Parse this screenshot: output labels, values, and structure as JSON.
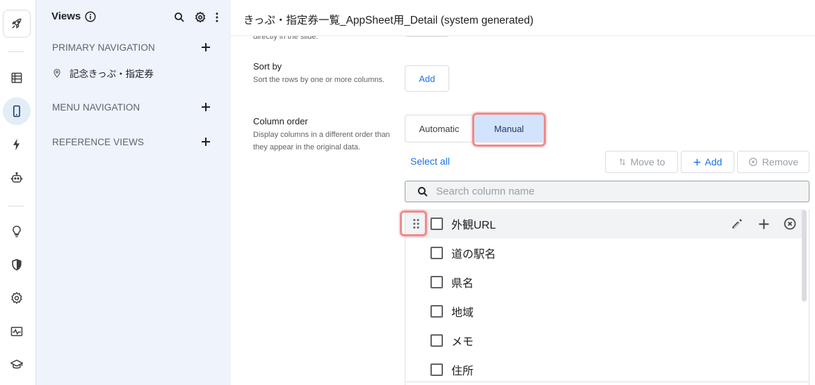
{
  "rail": {
    "items": [
      {
        "name": "appsheet-logo-icon"
      },
      {
        "name": "data-icon"
      },
      {
        "name": "views-icon"
      },
      {
        "name": "automation-icon"
      },
      {
        "name": "bot-icon"
      },
      {
        "name": "lightbulb-icon"
      },
      {
        "name": "security-icon"
      },
      {
        "name": "settings-icon"
      },
      {
        "name": "monitor-icon"
      },
      {
        "name": "learn-icon"
      }
    ]
  },
  "views_panel": {
    "title": "Views",
    "sections": {
      "primary": "PRIMARY NAVIGATION",
      "menu": "MENU NAVIGATION",
      "reference": "REFERENCE VIEWS"
    },
    "primary_items": [
      "記念きっぷ・指定券"
    ]
  },
  "header": {
    "title": "きっぷ・指定券一覧_AppSheet用_Detail (system generated)"
  },
  "main": {
    "cut_desc": "directly in the slide.",
    "sort_by": {
      "label": "Sort by",
      "desc": "Sort the rows by one or more columns.",
      "add_label": "Add"
    },
    "column_order": {
      "label": "Column order",
      "desc": "Display columns in a different order than they appear in the original data.",
      "options": [
        "Automatic",
        "Manual"
      ],
      "selected": "Manual"
    },
    "toolbar": {
      "select_all": "Select all",
      "move_to": "Move to",
      "add": "Add",
      "remove": "Remove"
    },
    "search": {
      "placeholder": "Search column name",
      "value": ""
    },
    "columns": [
      "外観URL",
      "道の駅名",
      "県名",
      "地域",
      "メモ",
      "住所"
    ]
  },
  "colors": {
    "accent": "#1a73e8",
    "selected_bg": "#d3e3fd",
    "panel_bg": "#eef3fc",
    "highlight": "#ef8a8a"
  }
}
